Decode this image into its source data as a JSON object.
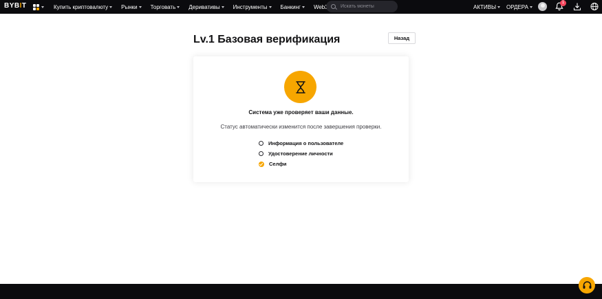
{
  "brand": {
    "logo_text_a": "BYB",
    "logo_text_dot": "I",
    "logo_text_b": "T",
    "accent_color": "#f7a600"
  },
  "nav": {
    "items": [
      {
        "label": "Купить криптовалюту",
        "has_dropdown": true
      },
      {
        "label": "Рынки",
        "has_dropdown": true
      },
      {
        "label": "Торговать",
        "has_dropdown": true
      },
      {
        "label": "Деривативы",
        "has_dropdown": true
      },
      {
        "label": "Инструменты",
        "has_dropdown": true
      },
      {
        "label": "Банкинг",
        "has_dropdown": true
      },
      {
        "label": "Web3",
        "has_dropdown": true
      }
    ],
    "search_placeholder": "Искать монеты",
    "assets_label": "АКТИВЫ",
    "orders_label": "ОРДЕРА",
    "notification_count": "1",
    "icons": [
      "apps-grid-icon",
      "search-icon",
      "avatar",
      "bell-icon",
      "download-icon",
      "globe-icon"
    ]
  },
  "page": {
    "title": "Lv.1 Базовая верификация",
    "back_label": "Назад"
  },
  "status": {
    "icon": "hourglass-icon",
    "headline": "Система уже проверяет ваши данные.",
    "description": "Статус автоматически изменится после завершения проверки."
  },
  "steps": [
    {
      "label": "Информация о пользователе",
      "state": "pending"
    },
    {
      "label": "Удостоверение личности",
      "state": "pending"
    },
    {
      "label": "Селфи",
      "state": "done"
    }
  ],
  "support": {
    "icon": "headset-icon"
  }
}
